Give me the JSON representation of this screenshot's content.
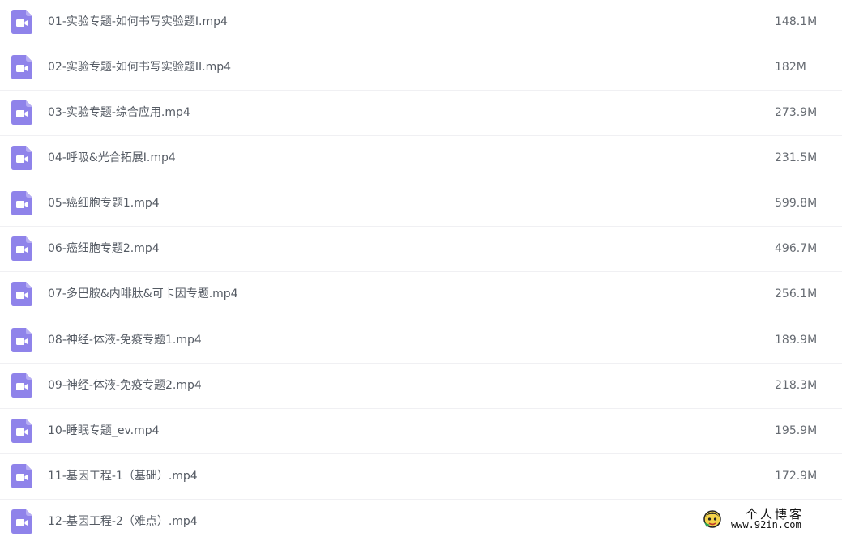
{
  "colors": {
    "icon_bg": "#8f83ea",
    "icon_fg": "#ffffff",
    "text": "#555b64",
    "divider": "#f0f0f3"
  },
  "file_icon": "video-file-icon",
  "files": [
    {
      "name": "01-实验专题-如何书写实验题I.mp4",
      "size": "148.1M"
    },
    {
      "name": "02-实验专题-如何书写实验题II.mp4",
      "size": "182M"
    },
    {
      "name": "03-实验专题-综合应用.mp4",
      "size": "273.9M"
    },
    {
      "name": "04-呼吸&光合拓展I.mp4",
      "size": "231.5M"
    },
    {
      "name": "05-癌细胞专题1.mp4",
      "size": "599.8M"
    },
    {
      "name": "06-癌细胞专题2.mp4",
      "size": "496.7M"
    },
    {
      "name": "07-多巴胺&内啡肽&可卡因专题.mp4",
      "size": "256.1M"
    },
    {
      "name": "08-神经-体液-免疫专题1.mp4",
      "size": "189.9M"
    },
    {
      "name": "09-神经-体液-免疫专题2.mp4",
      "size": "218.3M"
    },
    {
      "name": "10-睡眠专题_ev.mp4",
      "size": "195.9M"
    },
    {
      "name": "11-基因工程-1（基础）.mp4",
      "size": "172.9M"
    },
    {
      "name": "12-基因工程-2（难点）.mp4",
      "size": ""
    }
  ],
  "watermark": {
    "title": "个人博客",
    "url": "www.92in.com"
  }
}
